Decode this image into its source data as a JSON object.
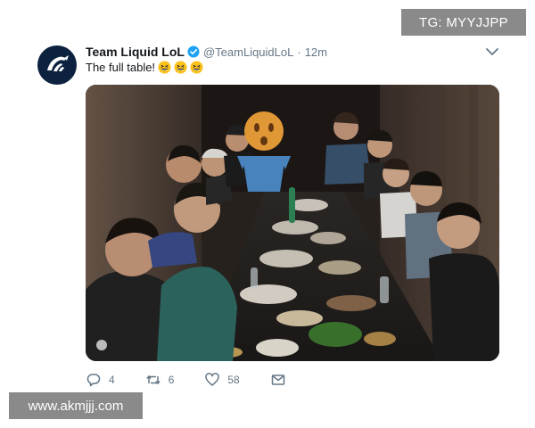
{
  "tweet": {
    "author_name": "Team Liquid LoL",
    "author_handle": "@TeamLiquidLoL",
    "separator": "·",
    "time": "12m",
    "text": "The full table!",
    "emoji": [
      "grinning-squint-face",
      "grinning-squint-face",
      "grinning-squint-face"
    ],
    "verified": true,
    "icons": {
      "avatar": "team-liquid-horse-logo",
      "menu": "chevron-down-icon"
    }
  },
  "actions": {
    "reply_count": "4",
    "retweet_count": "6",
    "like_count": "58",
    "message_count": ""
  },
  "watermarks": {
    "top_right": "TG: MYYJJPP",
    "bottom_left": "www.akmjjj.com"
  },
  "colors": {
    "verified_blue": "#1da1f2",
    "muted_text": "#657786",
    "avatar_bg": "#0c223f",
    "watermark_bg": "#8a8a8a"
  }
}
